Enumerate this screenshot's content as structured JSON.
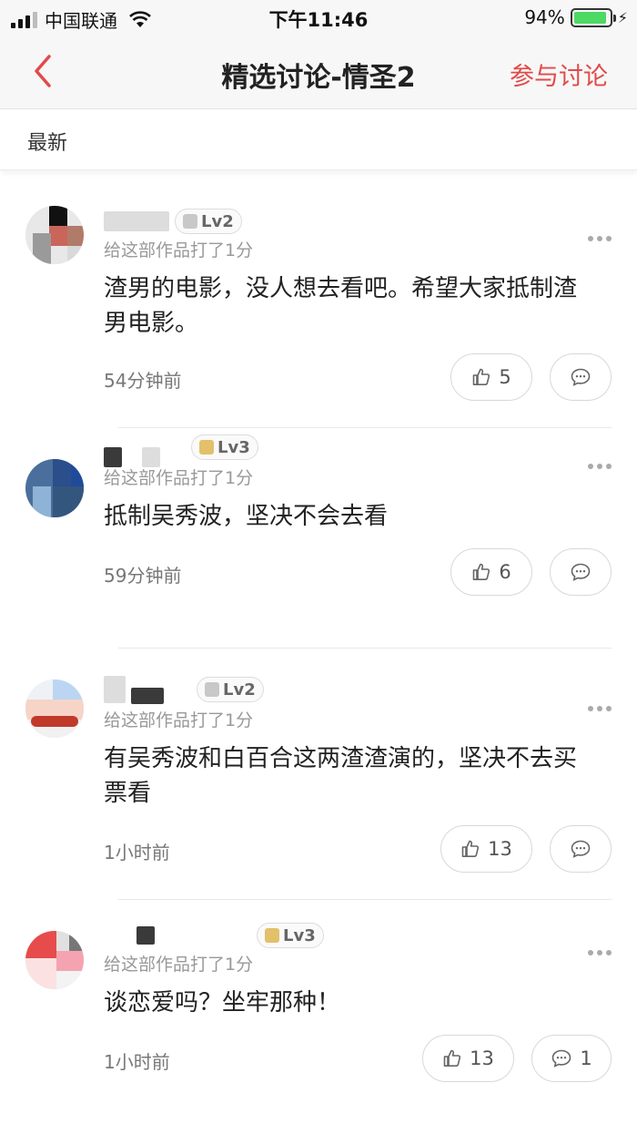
{
  "status_bar": {
    "carrier": "中国联通",
    "time": "下午11:46",
    "battery": "94%",
    "battery_level": 0.94
  },
  "nav": {
    "back_icon": "chevron-left-icon",
    "title": "精选讨论-情圣2",
    "action": "参与讨论"
  },
  "sort": {
    "label": "最新"
  },
  "colors": {
    "accent": "#e24a4a",
    "battery": "#4cd964"
  },
  "posts": [
    {
      "level": "Lv2",
      "rating_text": "给这部作品打了1分",
      "content": "渣男的电影，没人想去看吧。希望大家抵制渣男电影。",
      "time": "54分钟前",
      "likes": "5",
      "comments": ""
    },
    {
      "level": "Lv3",
      "rating_text": "给这部作品打了1分",
      "content": "抵制吴秀波，坚决不会去看",
      "time": "59分钟前",
      "likes": "6",
      "comments": ""
    },
    {
      "level": "Lv2",
      "rating_text": "给这部作品打了1分",
      "content": "有吴秀波和白百合这两渣渣演的，坚决不去买票看",
      "time": "1小时前",
      "likes": "13",
      "comments": ""
    },
    {
      "level": "Lv3",
      "rating_text": "给这部作品打了1分",
      "content": "谈恋爱吗？坐牢那种！",
      "time": "1小时前",
      "likes": "13",
      "comments": "1"
    }
  ]
}
